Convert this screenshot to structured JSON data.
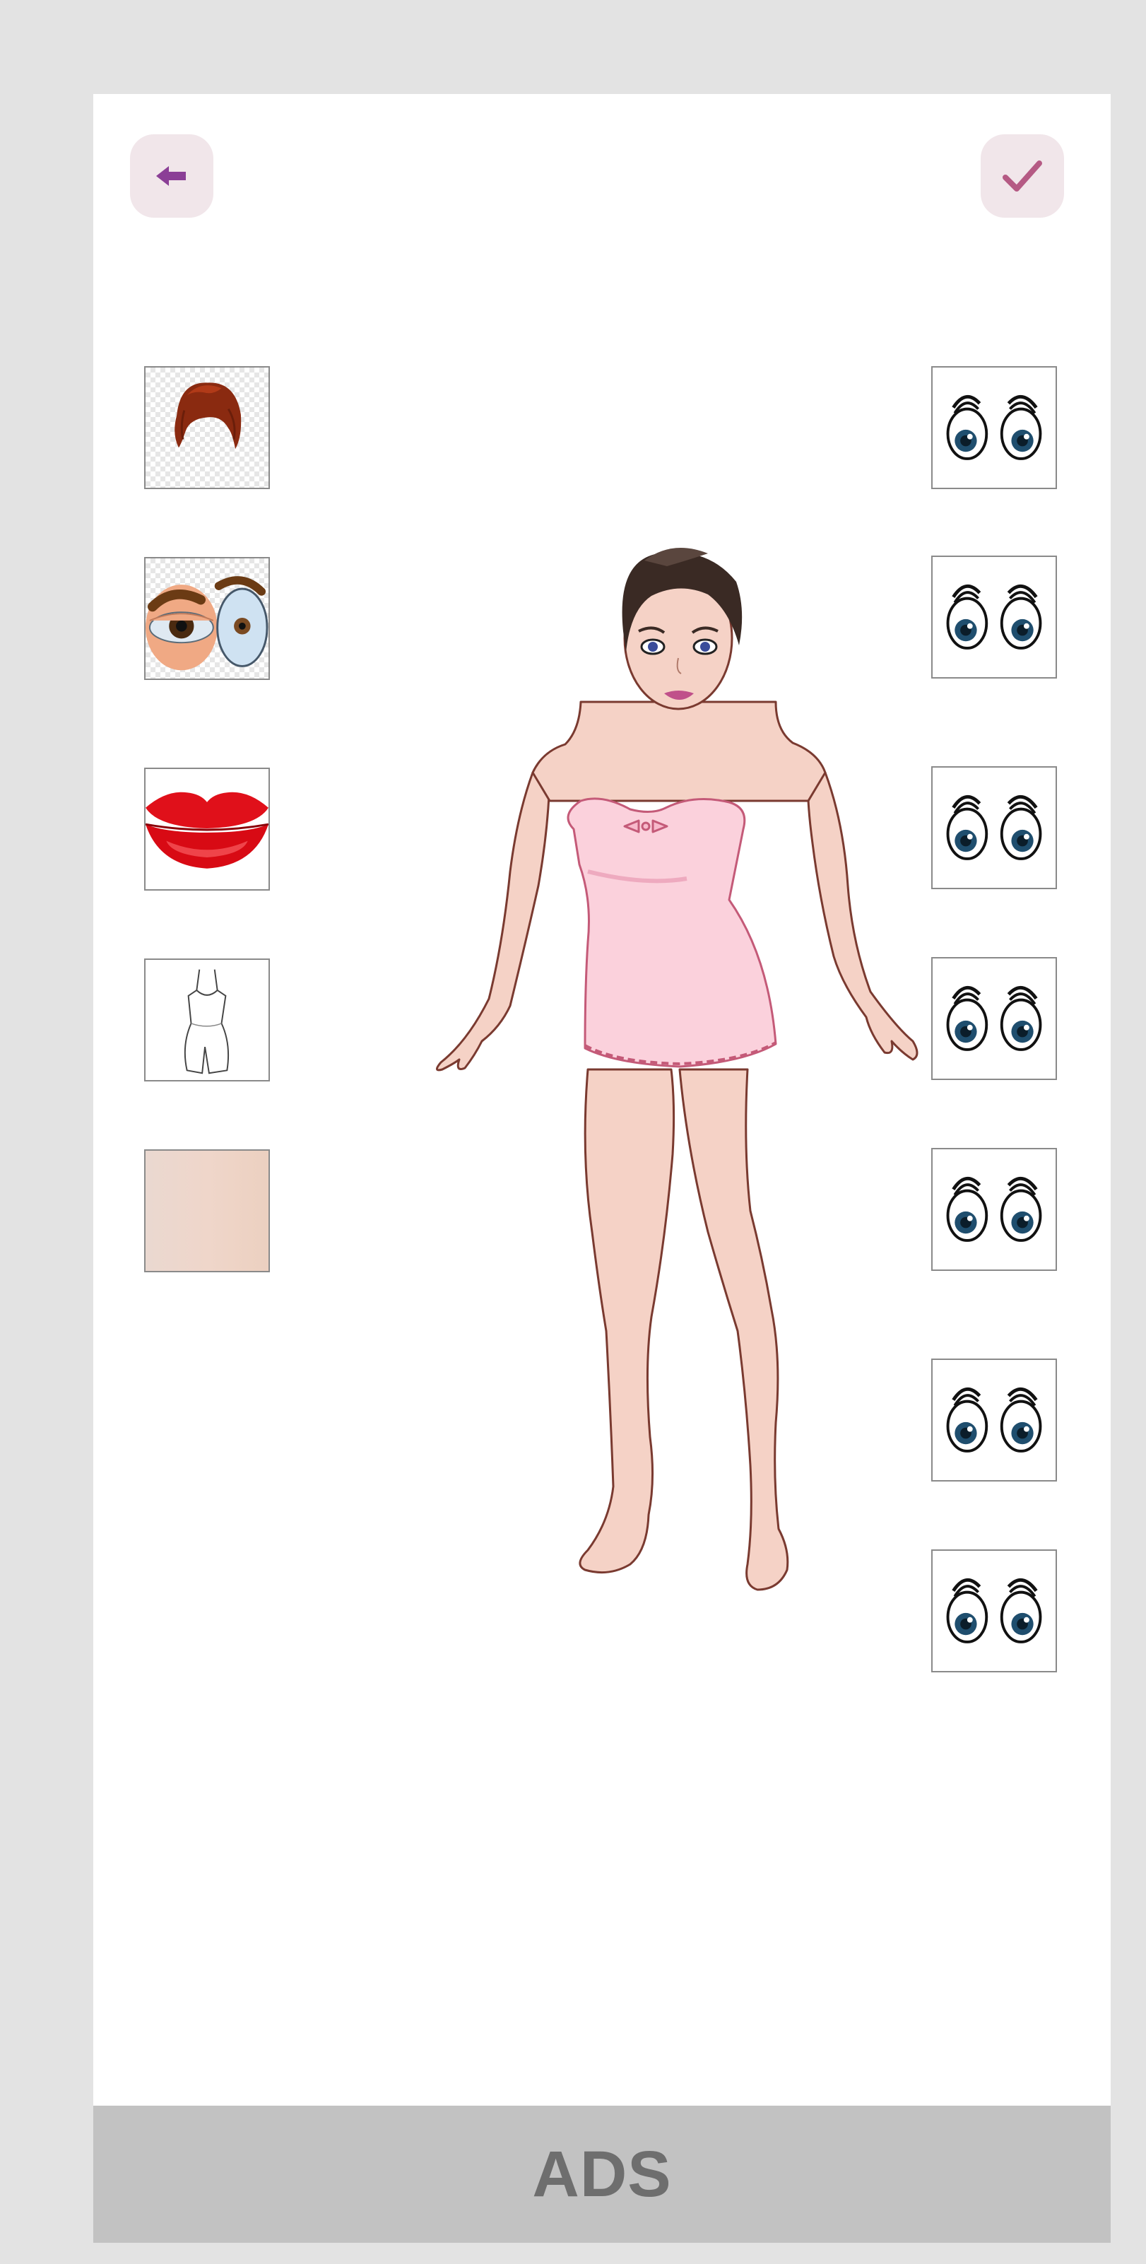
{
  "app": {
    "back_icon": "arrow-left-icon",
    "confirm_icon": "checkmark-icon"
  },
  "colors": {
    "background": "#e3e3e3",
    "panel": "#ffffff",
    "button_bg": "#f1e6ea",
    "back_arrow": "#8b3f96",
    "check": "#b55a84",
    "ads_bg": "#c2c2c2",
    "ads_text": "#6e6e6e"
  },
  "left_palette": [
    {
      "icon": "hair-icon"
    },
    {
      "icon": "eyes-style-icon"
    },
    {
      "icon": "lips-icon"
    },
    {
      "icon": "dress-icon"
    },
    {
      "icon": "skin-tone-icon"
    }
  ],
  "right_palette": [
    {
      "icon": "eyes-option-icon"
    },
    {
      "icon": "eyes-option-icon"
    },
    {
      "icon": "eyes-option-icon"
    },
    {
      "icon": "eyes-option-icon"
    },
    {
      "icon": "eyes-option-icon"
    },
    {
      "icon": "eyes-option-icon"
    },
    {
      "icon": "eyes-option-icon"
    }
  ],
  "ads": {
    "label": "ADS"
  }
}
